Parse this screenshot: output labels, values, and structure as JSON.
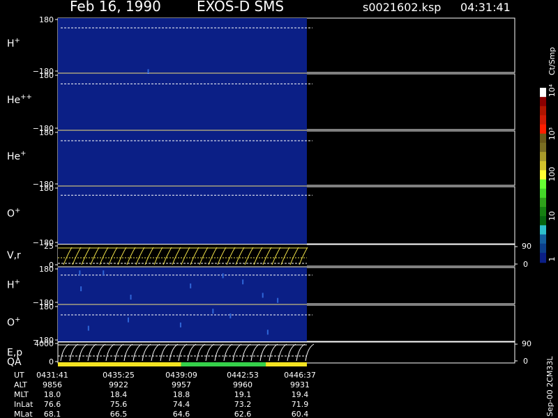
{
  "header": {
    "date": "Feb 16, 1990",
    "instrument": "EXOS-D SMS",
    "file": "s0021602.ksp",
    "time": "04:31:41"
  },
  "colors": {
    "background": "#000000",
    "fill_low": "#0b1f86",
    "pixel": "#2f66d8",
    "dash": "#ffffff",
    "guide": "#f1e34a",
    "curve": "#ffffff",
    "qa_yellow": "#f3e321",
    "qa_green": "#35d04a"
  },
  "chart_data": {
    "type": "heatmap",
    "x_time_ut": [
      "0431:41",
      "0435:25",
      "0439:09",
      "0442:53",
      "0446:37"
    ],
    "data_extent_fraction": 1.0,
    "panels": [
      {
        "key": "h1",
        "label": "H",
        "superscript": "+",
        "yticks": [
          "180",
          "−180"
        ],
        "dash_level": 0.82
      },
      {
        "key": "he2",
        "label": "He",
        "superscript": "++",
        "yticks": [
          "180",
          "−180"
        ],
        "dash_level": 0.82
      },
      {
        "key": "he1",
        "label": "He",
        "superscript": "+",
        "yticks": [
          "180",
          "−180"
        ],
        "dash_level": 0.82
      },
      {
        "key": "o1",
        "label": "O",
        "superscript": "+",
        "yticks": [
          "180",
          "−180"
        ],
        "dash_level": 0.85
      },
      {
        "key": "vr",
        "label": "V,r",
        "superscript": "",
        "yticks": [
          "25",
          "0"
        ],
        "right_ticks": [
          "90",
          "0"
        ]
      },
      {
        "key": "h2",
        "label": "H",
        "superscript": "+",
        "yticks": [
          "180",
          "−180"
        ],
        "dash_level": 0.79
      },
      {
        "key": "o2",
        "label": "O",
        "superscript": "+",
        "yticks": [
          "180",
          "−180"
        ],
        "dash_level": 0.73
      },
      {
        "key": "ep",
        "label": "E,p",
        "superscript": "",
        "yticks": [
          "4000",
          "0"
        ],
        "right_ticks": [
          "90",
          "0"
        ]
      }
    ],
    "qa": {
      "label": "QA",
      "segments": [
        {
          "start": 0.0,
          "end": 0.495,
          "color": "#f3e321"
        },
        {
          "start": 0.495,
          "end": 0.835,
          "color": "#35d04a"
        },
        {
          "start": 0.835,
          "end": 1.0,
          "color": "#f3e321"
        }
      ]
    },
    "colorbar": {
      "title": "Ct/Smp",
      "tick_labels": [
        "10⁴",
        "10³",
        "100",
        "10",
        "1"
      ],
      "colors": [
        "#ffffff",
        "#8b0000",
        "#b01500",
        "#d01b05",
        "#ff1e00",
        "#6a5a1a",
        "#7a6e22",
        "#a89a2a",
        "#d3c32d",
        "#ffff33",
        "#66ff33",
        "#44d628",
        "#2fa01b",
        "#168012",
        "#066610",
        "#2ec1cc",
        "#145f9e",
        "#0c3f8b",
        "#0b1f86"
      ]
    },
    "sparse_pixels": {
      "h1": [
        [
          0.36,
          0.94
        ]
      ],
      "h2": [
        [
          0.085,
          0.08
        ],
        [
          0.18,
          0.08
        ],
        [
          0.09,
          0.52
        ],
        [
          0.29,
          0.75
        ],
        [
          0.53,
          0.44
        ],
        [
          0.66,
          0.16
        ],
        [
          0.74,
          0.33
        ],
        [
          0.82,
          0.7
        ],
        [
          0.88,
          0.84
        ]
      ],
      "o2": [
        [
          0.12,
          0.57
        ],
        [
          0.28,
          0.34
        ],
        [
          0.62,
          0.1
        ],
        [
          0.69,
          0.23
        ],
        [
          0.84,
          0.68
        ],
        [
          0.49,
          0.48
        ]
      ]
    }
  },
  "footer": {
    "rows": [
      {
        "label": "UT",
        "values": [
          "0431:41",
          "0435:25",
          "0439:09",
          "0442:53",
          "0446:37"
        ]
      },
      {
        "label": "ALT",
        "values": [
          "9856",
          "9922",
          "9957",
          "9960",
          "9931"
        ]
      },
      {
        "label": "MLT",
        "values": [
          "18.0",
          "18.4",
          "18.8",
          "19.1",
          "19.4"
        ]
      },
      {
        "label": "InLat",
        "values": [
          "76.6",
          "75.6",
          "74.4",
          "73.2",
          "71.9"
        ]
      },
      {
        "label": "MLat",
        "values": [
          "68.1",
          "66.5",
          "64.6",
          "62.6",
          "60.4"
        ]
      }
    ],
    "side_text": "Sep-00  2CM33L"
  }
}
